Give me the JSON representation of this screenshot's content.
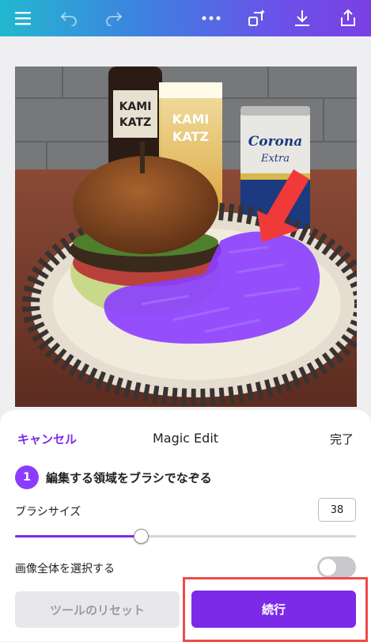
{
  "toolbar": {
    "icons": [
      "menu-icon",
      "undo-icon",
      "redo-icon",
      "more-icon",
      "magic-resize-icon",
      "download-icon",
      "share-icon"
    ]
  },
  "photo": {
    "label_can": "Corona Extra",
    "label_bottle": "KAMI KATZ"
  },
  "panel": {
    "cancel_label": "キャンセル",
    "title": "Magic Edit",
    "done_label": "完了",
    "step_number": "1",
    "step_text": "編集する領域をブラシでなぞる",
    "brush_size_label": "ブラシサイズ",
    "brush_size_value": "38",
    "brush_slider_fraction": 0.37,
    "select_all_label": "画像全体を選択する",
    "select_all_on": false,
    "reset_label": "ツールのリセット",
    "continue_label": "続行"
  },
  "colors": {
    "accent": "#7d2ae8",
    "mask": "#8b3dff",
    "highlight": "#ef4b4b",
    "arrow": "#f03a3a"
  }
}
